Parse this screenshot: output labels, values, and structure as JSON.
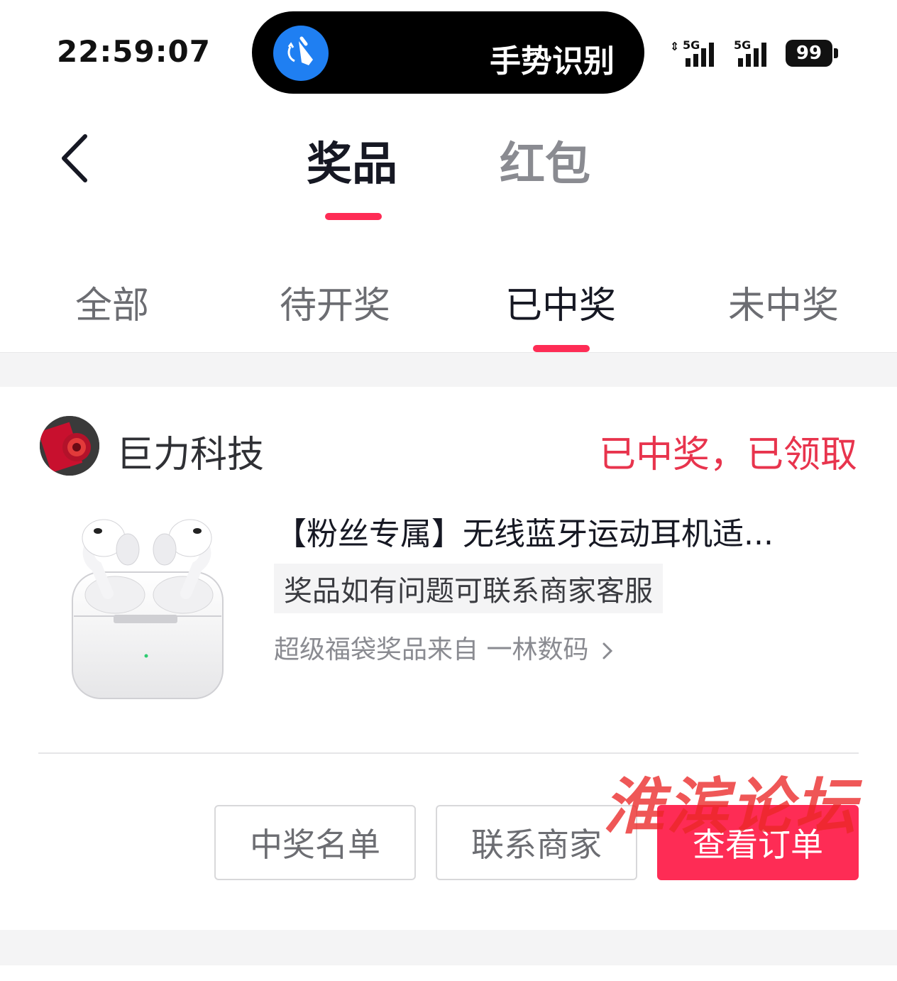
{
  "status_bar": {
    "time": "22:59:07",
    "island_text": "手势识别",
    "network_1": "5G",
    "network_2": "5G",
    "battery": "99"
  },
  "header": {
    "tabs": [
      {
        "label": "奖品",
        "active": true
      },
      {
        "label": "红包",
        "active": false
      }
    ]
  },
  "filters": {
    "tabs": [
      {
        "label": "全部",
        "active": false
      },
      {
        "label": "待开奖",
        "active": false
      },
      {
        "label": "已中奖",
        "active": true
      },
      {
        "label": "未中奖",
        "active": false
      }
    ]
  },
  "card": {
    "shop_name": "巨力科技",
    "status": "已中奖，已领取",
    "product_title": "【粉丝专属】无线蓝牙运动耳机适...",
    "contact_note": "奖品如有问题可联系商家客服",
    "source": "超级福袋奖品来自 一林数码",
    "buttons": {
      "winners": "中奖名单",
      "contact": "联系商家",
      "order": "查看订单"
    }
  },
  "watermark": "淮滨论坛",
  "colors": {
    "accent": "#fe2c55",
    "status_red": "#e8344d",
    "gesture_blue": "#1f7ff2"
  },
  "icons": {
    "back": "chevron-left-icon",
    "gesture": "hand-gesture-icon",
    "source_arrow": "chevron-right-icon"
  }
}
